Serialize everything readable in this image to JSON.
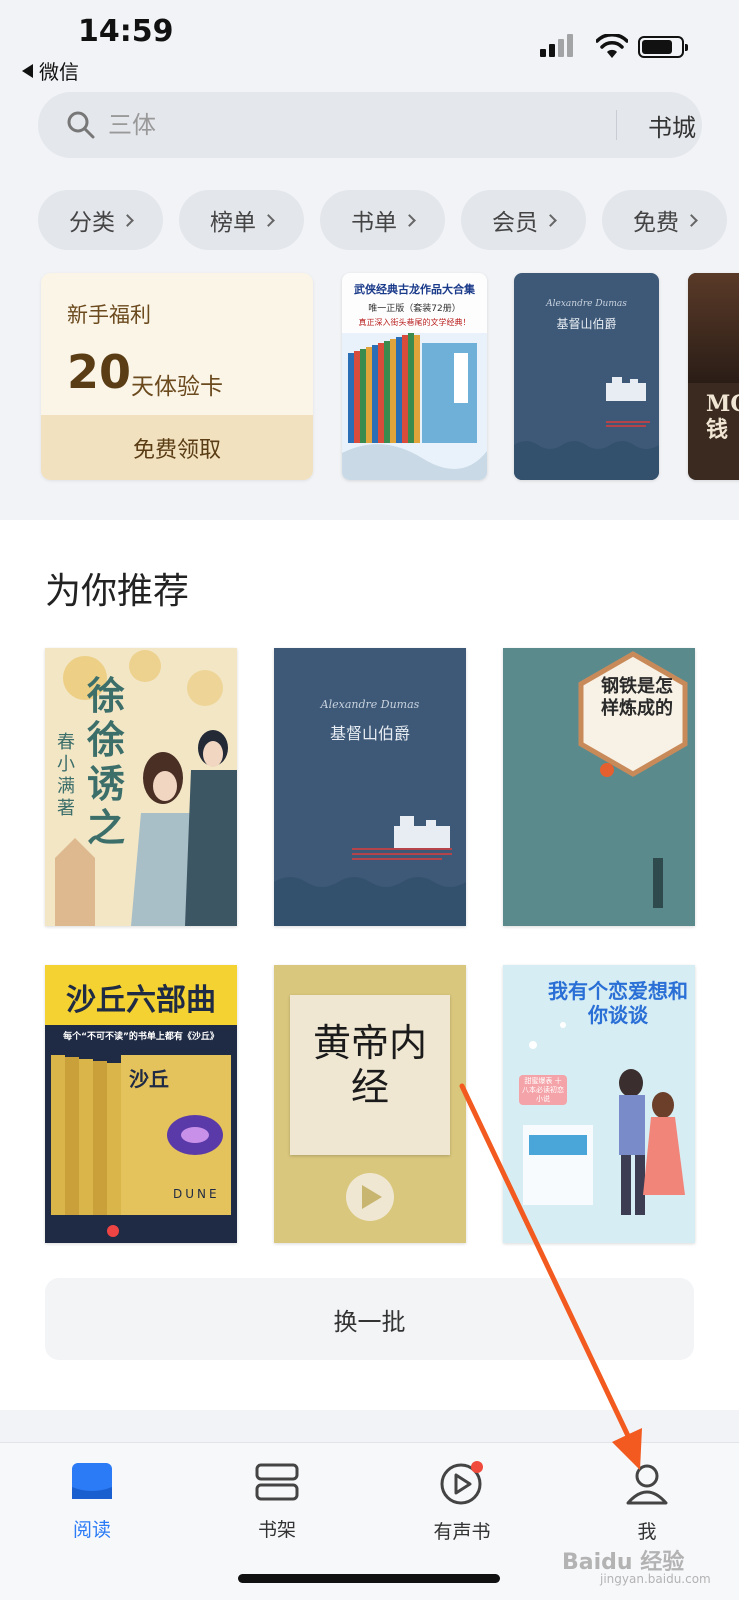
{
  "status_bar": {
    "time": "14:59",
    "back_app": "微信"
  },
  "search": {
    "placeholder": "三体",
    "bookstore": "书城"
  },
  "chips": [
    "分类",
    "榜单",
    "书单",
    "会员",
    "免费"
  ],
  "welfare": {
    "title": "新手福利",
    "days": "20",
    "unit": "天体验卡",
    "button": "免费领取"
  },
  "banner_books": [
    {
      "title": "武侠经典古龙作品大合集",
      "subtitle": "唯一正版（套装72册）",
      "tagline": "真正深入街头巷尾的文学经典！",
      "colors": [
        "#fdfdfd",
        "#e1f0ff"
      ]
    },
    {
      "title": "基督山伯爵",
      "author": "Alexandre Dumas",
      "colors": [
        "#3e5978"
      ]
    },
    {
      "title": "MC 钱",
      "colors": [
        "#3a2a20"
      ]
    }
  ],
  "recommend": {
    "title": "为你推荐",
    "refresh": "换一批",
    "books": [
      {
        "title": "徐徐诱之",
        "author": "春小满 著",
        "bg": "#f3e6c5"
      },
      {
        "title": "基督山伯爵",
        "author": "Alexandre Dumas",
        "bg": "#3e5978"
      },
      {
        "title": "钢铁是怎样炼成的",
        "bg": "#5b8a8d"
      },
      {
        "title": "沙丘六部曲",
        "subtitle": "每个“不可不读”的书单上都有《沙丘》",
        "cover_text": "沙丘",
        "dune": "DUNE",
        "bg": "#1f2a44"
      },
      {
        "title": "黄帝内经",
        "bg": "#d9c77d"
      },
      {
        "title": "我有个恋爱想和你谈谈",
        "badge": "甜蜜爆表 十八本必读初恋小说",
        "bg": "#d6edf3"
      }
    ]
  },
  "tabbar": {
    "items": [
      "阅读",
      "书架",
      "有声书",
      "我"
    ],
    "active_color": "#2a7bf5",
    "badge_color": "#f04a3c"
  },
  "watermark": {
    "brand": "Baidu 经验",
    "url": "jingyan.baidu.com"
  }
}
